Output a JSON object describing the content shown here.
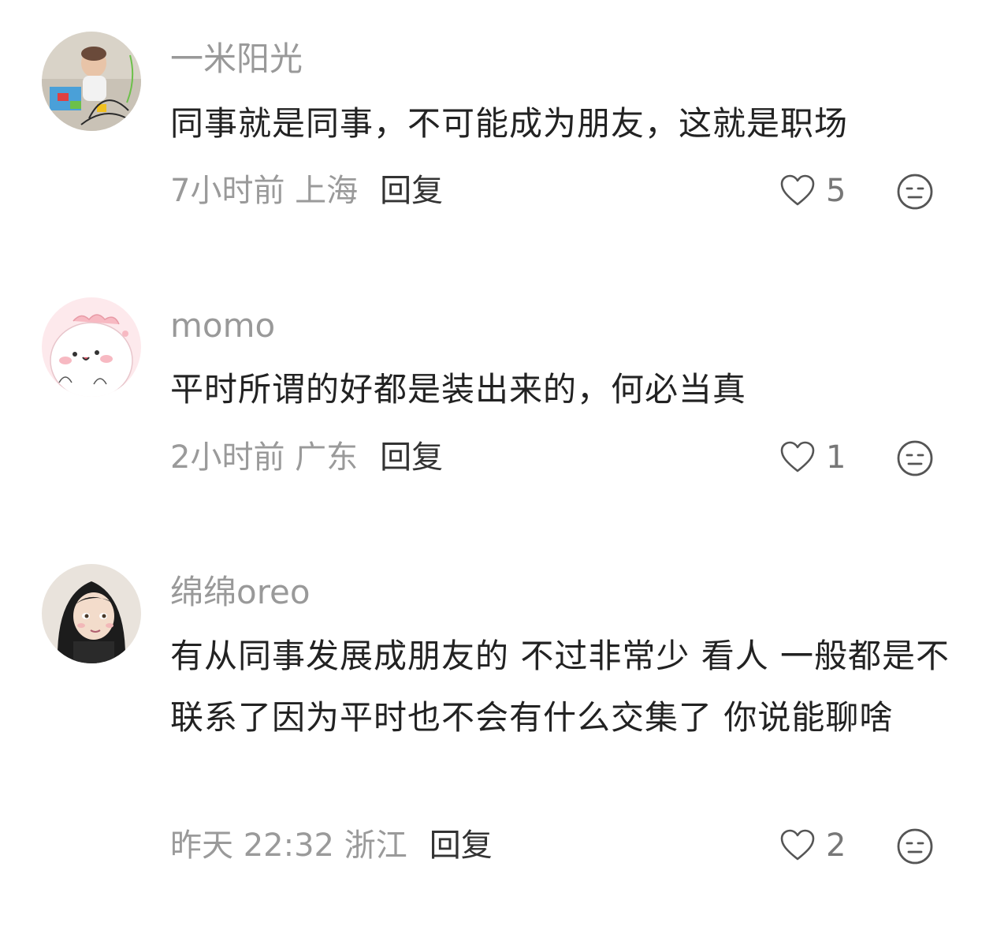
{
  "comments": [
    {
      "username": "一米阳光",
      "text": "同事就是同事，不可能成为朋友，这就是职场",
      "meta": "7小时前 上海",
      "reply_label": "回复",
      "likes": "5"
    },
    {
      "username": "momo",
      "text": "平时所谓的好都是装出来的，何必当真",
      "meta": "2小时前 广东",
      "reply_label": "回复",
      "likes": "1"
    },
    {
      "username": "绵绵oreo",
      "text": "有从同事发展成朋友的 不过非常少 看人 一般都是不联系了因为平时也不会有什么交集了 你说能聊啥",
      "meta": "昨天 22:32 浙江",
      "reply_label": "回复",
      "likes": "2"
    }
  ],
  "icons": {
    "like": "heart-outline-icon",
    "dislike": "neutral-face-icon"
  },
  "colors": {
    "username": "#999999",
    "text": "#222222",
    "meta": "#9a9a9a",
    "reply": "#333333",
    "icon": "#555555"
  }
}
